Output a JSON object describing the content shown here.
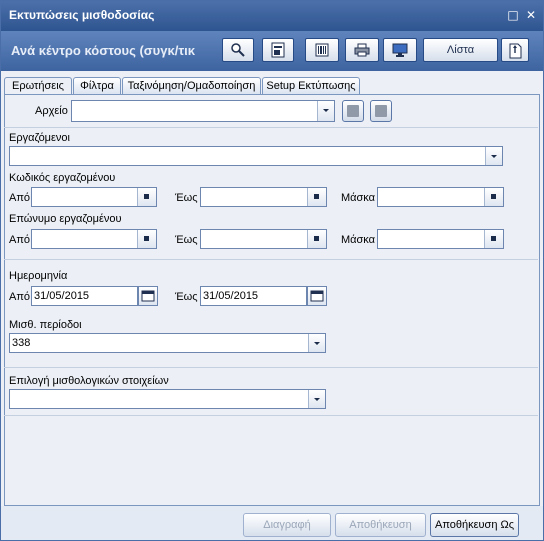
{
  "window": {
    "title": "Εκτυπώσεις μισθοδοσίας",
    "minimize_glyph": "□",
    "close_glyph": "✕"
  },
  "header": {
    "subtitle": "Ανά κέντρο κόστους (συγκ/τικ",
    "list_label": "Λίστα",
    "icons": [
      "search-icon",
      "report-icon",
      "barcode-icon",
      "printer-icon",
      "monitor-icon",
      "list-button",
      "export-icon"
    ]
  },
  "tabs": [
    {
      "label": "Ερωτήσεις"
    },
    {
      "label": "Φίλτρα"
    },
    {
      "label": "Ταξινόμηση/Ομαδοποίηση"
    },
    {
      "label": "Setup Εκτύπωσης"
    }
  ],
  "form": {
    "file_label": "Αρχείο",
    "file_value": "",
    "employees_label": "Εργαζόμενοι",
    "employees_value": "",
    "emp_code_label": "Κωδικός εργαζομένου",
    "emp_surname_label": "Επώνυμο εργαζομένου",
    "from_label": "Από",
    "to_label": "Έως",
    "mask_label": "Μάσκα",
    "date_label": "Ημερομηνία",
    "date_from": "31/05/2015",
    "date_to": "31/05/2015",
    "period_label": "Μισθ. περίοδοι",
    "period_value": "338",
    "payroll_items_label": "Επιλογή μισθολογικών στοιχείων",
    "payroll_items_value": ""
  },
  "footer": {
    "delete_label": "Διαγραφή",
    "save_label": "Αποθήκευση",
    "save_as_label": "Αποθήκευση Ως"
  },
  "colors": {
    "title_bar": "#3a5f9b",
    "header": "#4f74ae",
    "panel": "#ecf0f6"
  }
}
